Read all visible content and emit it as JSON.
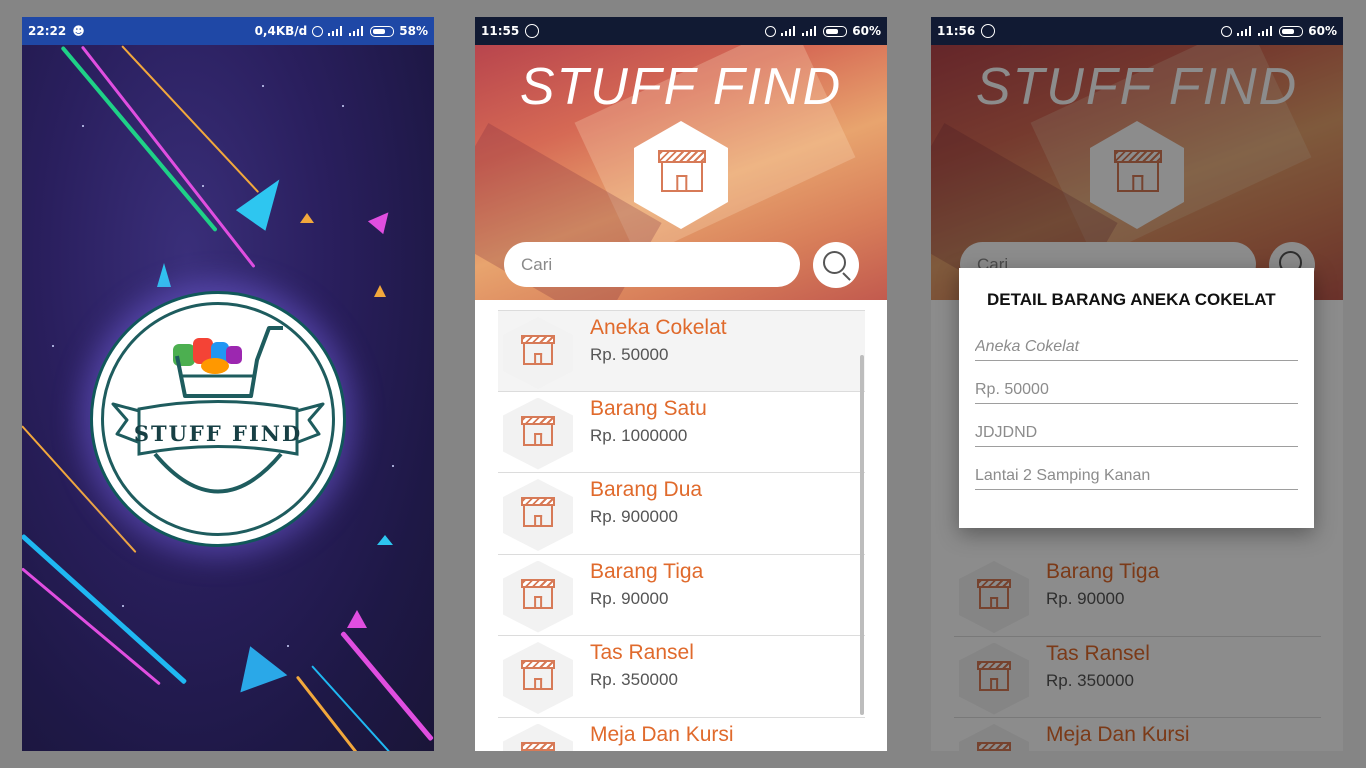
{
  "splash": {
    "status": {
      "time": "22:22",
      "speed": "0,4KB/d",
      "battery": "58%"
    },
    "logo_text": "STUFF FIND",
    "bg_color": "#241c4f"
  },
  "list_screen": {
    "status": {
      "time": "11:55",
      "battery": "60%"
    },
    "title": "STUFF FIND",
    "search": {
      "placeholder": "Cari"
    },
    "items": [
      {
        "name": "Aneka Cokelat",
        "price": "Rp. 50000"
      },
      {
        "name": "Barang Satu",
        "price": "Rp. 1000000"
      },
      {
        "name": "Barang Dua",
        "price": "Rp. 900000"
      },
      {
        "name": "Barang Tiga",
        "price": "Rp. 90000"
      },
      {
        "name": "Tas Ransel",
        "price": "Rp. 350000"
      },
      {
        "name": "Meja Dan Kursi",
        "price": ""
      }
    ],
    "accent_color": "#e06a2c"
  },
  "detail_screen": {
    "status": {
      "time": "11:56",
      "battery": "60%"
    },
    "title": "STUFF FIND",
    "search": {
      "placeholder": "Cari"
    },
    "dialog": {
      "title": "DETAIL BARANG ANEKA COKELAT",
      "fields": [
        "Aneka Cokelat",
        "Rp. 50000",
        "JDJDND",
        "Lantai 2 Samping Kanan"
      ]
    },
    "items": [
      {
        "name": "Barang Tiga",
        "price": "Rp. 90000"
      },
      {
        "name": "Tas Ransel",
        "price": "Rp. 350000"
      },
      {
        "name": "Meja Dan Kursi",
        "price": ""
      }
    ]
  }
}
